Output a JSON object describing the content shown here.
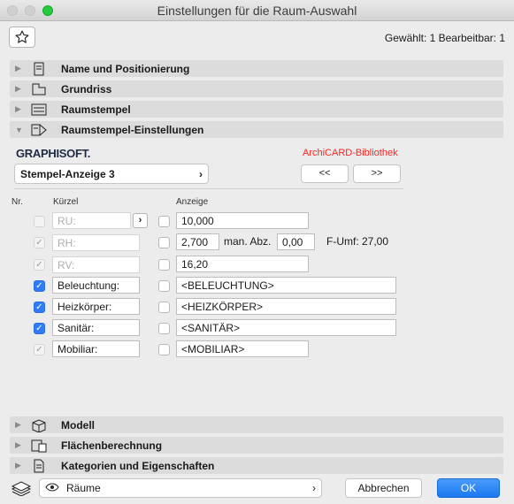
{
  "window": {
    "title": "Einstellungen für die Raum-Auswahl"
  },
  "selection_info": "Gewählt: 1 Bearbeitbar: 1",
  "sections": {
    "name": "Name und Positionierung",
    "grundriss": "Grundriss",
    "raumstempel": "Raumstempel",
    "raumstempel_settings": "Raumstempel-Einstellungen",
    "modell": "Modell",
    "flaechen": "Flächenberechnung",
    "kategorien": "Kategorien und Eigenschaften"
  },
  "panel": {
    "brand": "GRAPHISOFT.",
    "library": "ArchiCARD-Bibliothek",
    "stamp_select": "Stempel-Anzeige 3",
    "prev": "<<",
    "next": ">>",
    "col_nr": "Nr.",
    "col_kuerzel": "Kürzel",
    "col_anzeige": "Anzeige",
    "rows": [
      {
        "abbr": "RU:",
        "value": "10,000"
      },
      {
        "abbr": "RH:",
        "value": "2,700",
        "extra_label": "man. Abz.",
        "extra_value": "0,00",
        "note": "F-Umf: 27,00"
      },
      {
        "abbr": "RV:",
        "value": "16,20"
      },
      {
        "abbr": "Beleuchtung:",
        "value": "<BELEUCHTUNG>"
      },
      {
        "abbr": "Heizkörper:",
        "value": "<HEIZKÖRPER>"
      },
      {
        "abbr": "Sanitär:",
        "value": "<SANITÄR>"
      },
      {
        "abbr": "Mobiliar:",
        "value": "<MOBILIAR>"
      }
    ]
  },
  "footer": {
    "view": "Räume",
    "cancel": "Abbrechen",
    "ok": "OK"
  },
  "colors": {
    "accent": "#2f7cf6",
    "library_red": "#ff2020"
  },
  "icons": [
    "star-icon",
    "name-icon",
    "floorplan-icon",
    "stamp-icon",
    "stamp-settings-icon",
    "model-icon",
    "area-icon",
    "categories-icon",
    "layers-icon",
    "eye-icon"
  ]
}
